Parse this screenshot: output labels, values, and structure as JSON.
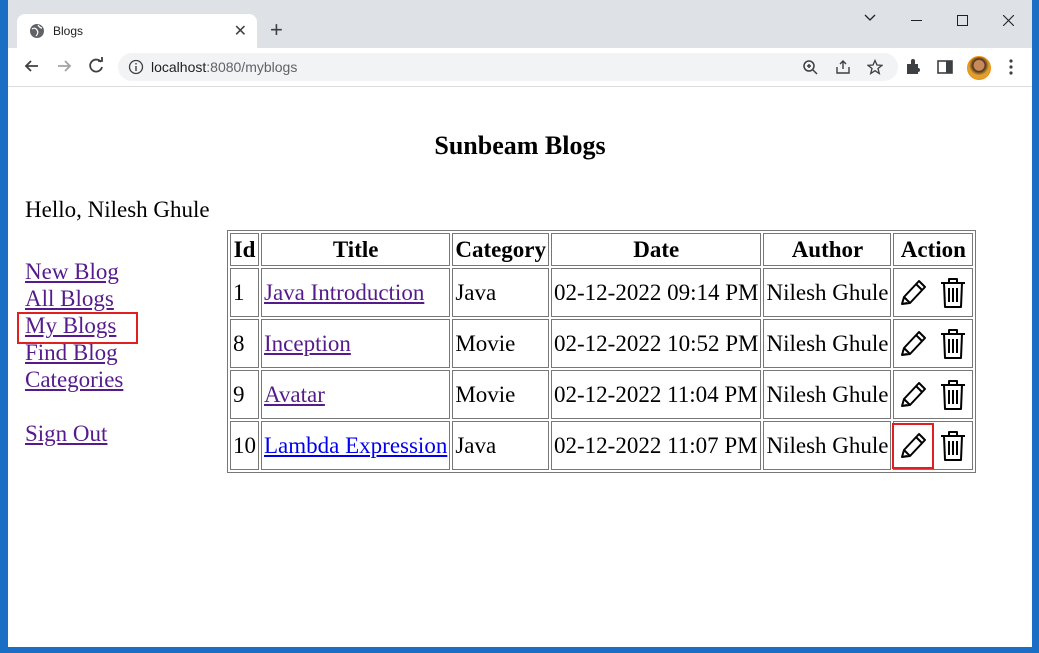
{
  "browser": {
    "tab_title": "Blogs",
    "tab_close": "✕",
    "new_tab": "+",
    "url_host": "localhost",
    "url_path": ":8080/myblogs"
  },
  "page": {
    "heading": "Sunbeam Blogs",
    "greeting": "Hello, Nilesh Ghule"
  },
  "nav": {
    "new_blog": "New Blog",
    "all_blogs": "All Blogs",
    "my_blogs": "My Blogs",
    "find_blog": "Find Blog",
    "categories": "Categories",
    "sign_out": "Sign Out"
  },
  "table": {
    "headers": [
      "Id",
      "Title",
      "Category",
      "Date",
      "Author",
      "Action"
    ],
    "rows": [
      {
        "id": "1",
        "title": "Java Introduction",
        "category": "Java",
        "date": "02-12-2022 09:14 PM",
        "author": "Nilesh Ghule"
      },
      {
        "id": "8",
        "title": "Inception",
        "category": "Movie",
        "date": "02-12-2022 10:52 PM",
        "author": "Nilesh Ghule"
      },
      {
        "id": "9",
        "title": "Avatar",
        "category": "Movie",
        "date": "02-12-2022 11:04 PM",
        "author": "Nilesh Ghule"
      },
      {
        "id": "10",
        "title": "Lambda Expression",
        "category": "Java",
        "date": "02-12-2022 11:07 PM",
        "author": "Nilesh Ghule"
      }
    ]
  },
  "colors": {
    "visited_link": "#551a8b",
    "unvisited_link": "#0000ee",
    "highlight_box": "#e02020"
  },
  "icons": [
    "globe-icon",
    "close-icon",
    "back-icon",
    "forward-icon",
    "reload-icon",
    "info-icon",
    "zoom-icon",
    "share-icon",
    "star-icon",
    "extensions-icon",
    "side-panel-icon",
    "menu-icon",
    "pencil-icon",
    "trash-icon"
  ]
}
